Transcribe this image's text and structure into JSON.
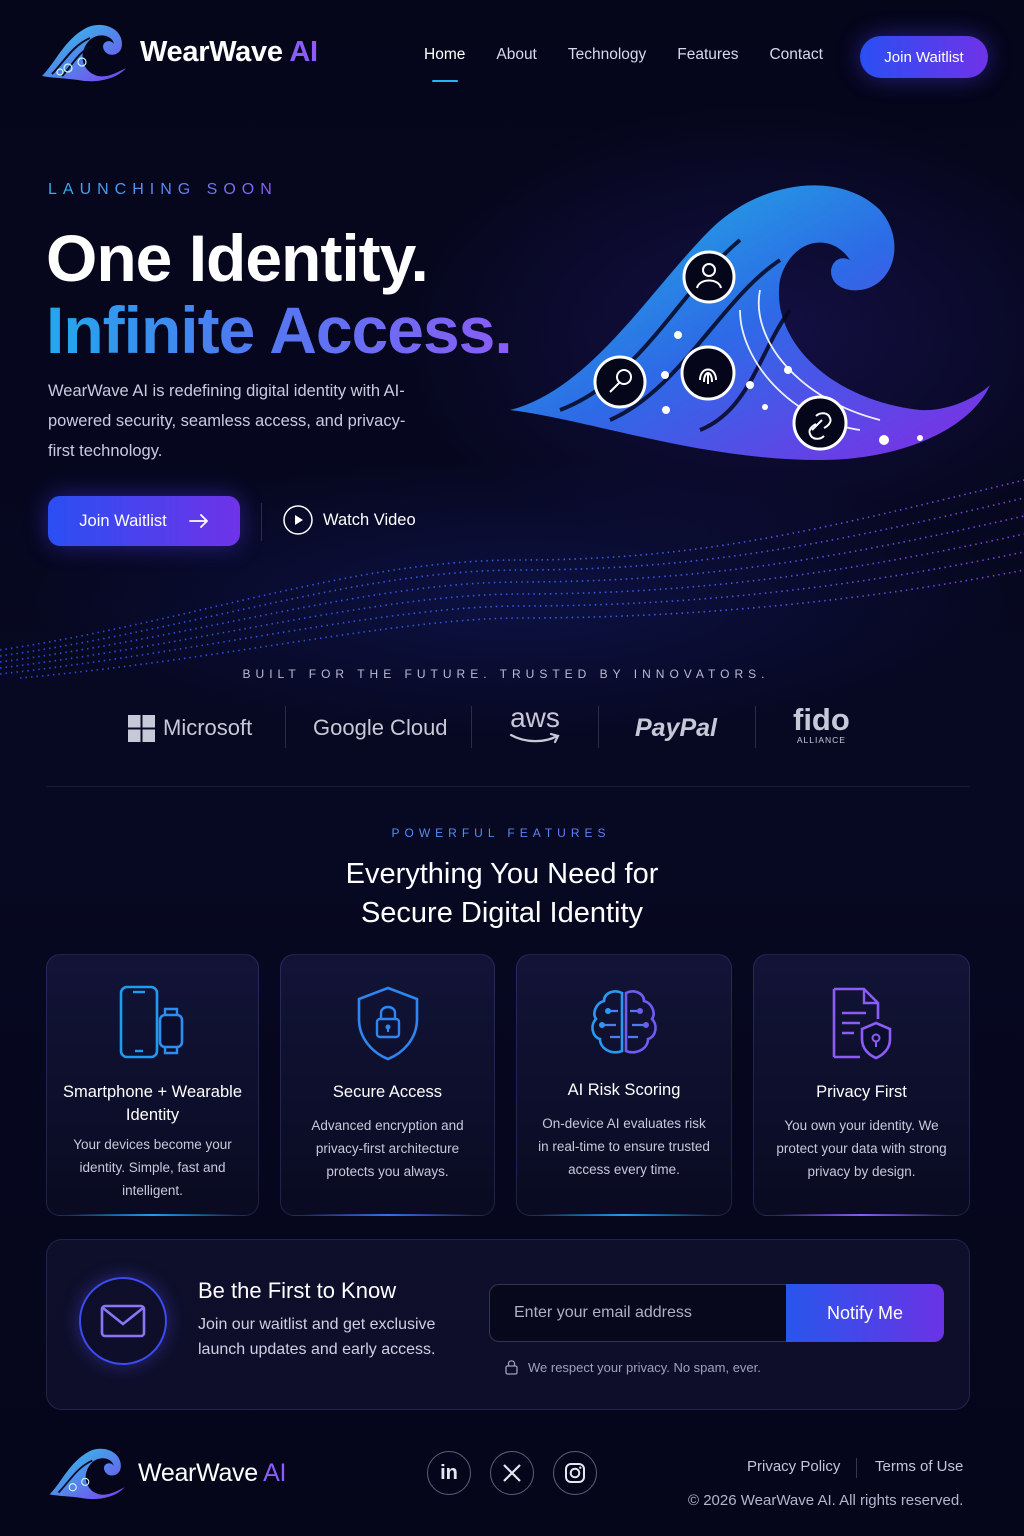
{
  "brand": {
    "name": "WearWave",
    "name_suffix": "AI"
  },
  "nav": {
    "items": [
      "Home",
      "About",
      "Technology",
      "Features",
      "Contact"
    ],
    "active": "Home",
    "cta": "Join Waitlist"
  },
  "hero": {
    "kicker": "LAUNCHING SOON",
    "title_line1": "One Identity.",
    "title_line2": "Infinite Access.",
    "description": "WearWave AI is redefining digital identity with AI-powered security, seamless access, and privacy-first technology.",
    "primary_button": "Join Waitlist",
    "secondary_button": "Watch Video",
    "illustration_icons": [
      "user-icon",
      "fingerprint-icon",
      "key-icon",
      "link-icon"
    ]
  },
  "trusted": {
    "label": "BUILT FOR THE FUTURE. TRUSTED BY INNOVATORS.",
    "brands": [
      "Microsoft",
      "Google Cloud",
      "aws",
      "PayPal",
      "fido"
    ],
    "fido_sub": "ALLIANCE"
  },
  "features": {
    "kicker": "POWERFUL FEATURES",
    "title_line1": "Everything You Need for",
    "title_line2": "Secure Digital Identity",
    "cards": [
      {
        "title": "Smartphone + Wearable Identity",
        "text": "Your devices become your identity. Simple, fast and intelligent.",
        "icon": "devices-icon"
      },
      {
        "title": "Secure Access",
        "text": "Advanced encryption and privacy-first architecture protects you always.",
        "icon": "shield-lock-icon"
      },
      {
        "title": "AI Risk Scoring",
        "text": "On-device AI evaluates risk in real-time to ensure trusted access every time.",
        "icon": "brain-icon"
      },
      {
        "title": "Privacy First",
        "text": "You own your identity. We protect your data with strong privacy by design.",
        "icon": "document-shield-icon"
      }
    ]
  },
  "cta": {
    "title": "Be the First to Know",
    "text": "Join our waitlist and get exclusive launch updates and early access.",
    "email_placeholder": "Enter your email address",
    "button": "Notify Me",
    "privacy_note": "We respect your privacy. No spam, ever."
  },
  "footer": {
    "social": [
      "linkedin-icon",
      "x-icon",
      "instagram-icon"
    ],
    "links": [
      "Privacy Policy",
      "Terms of Use"
    ],
    "copyright": "© 2026 WearWave AI. All rights reserved."
  },
  "colors": {
    "background": "#05061a",
    "accent_blue": "#2a4ff2",
    "accent_purple": "#8b5cf6",
    "accent_cyan": "#22b8ef"
  }
}
